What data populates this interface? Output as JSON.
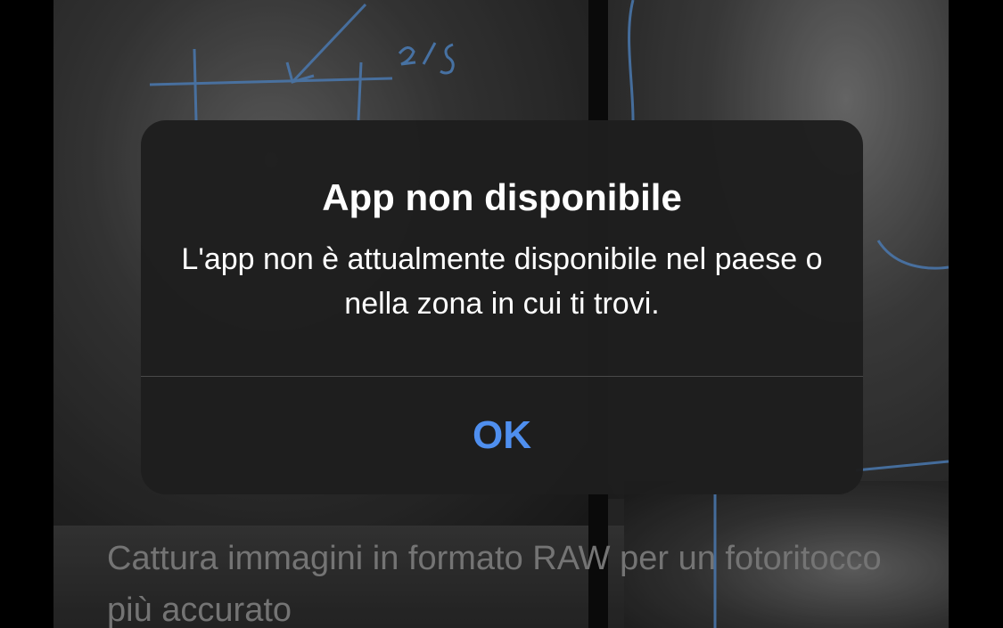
{
  "background": {
    "caption": "Cattura immagini in formato RAW per un fotoritocco più accurato"
  },
  "alert": {
    "title": "App non disponibile",
    "message": "L'app non è attualmente disponibile nel paese o nella zona in cui ti trovi.",
    "ok_label": "OK"
  },
  "colors": {
    "accent": "#4f8fef",
    "alert_bg": "#1e1e1e",
    "caption_text": "#8e8e8e"
  }
}
